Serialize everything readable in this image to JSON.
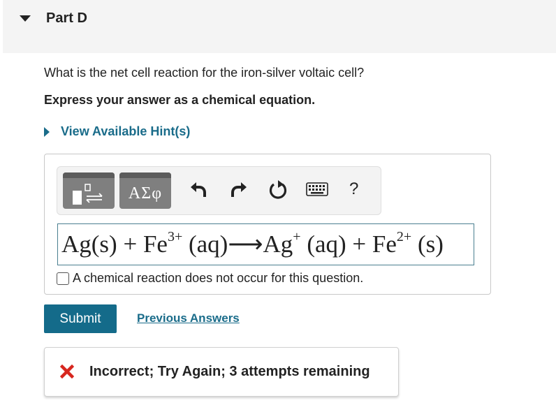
{
  "part": {
    "title": "Part D"
  },
  "question": {
    "text": "What is the net cell reaction for the iron-silver voltaic cell?"
  },
  "instruction": {
    "text": "Express your answer as a chemical equation."
  },
  "hints": {
    "label": "View Available Hint(s)"
  },
  "toolbar": {
    "templates_icon": "templates-icon",
    "symbols_label": "ΑΣφ",
    "undo_icon": "undo-icon",
    "redo_icon": "redo-icon",
    "reset_icon": "reset-icon",
    "keyboard_icon": "keyboard-icon",
    "help_label": "?"
  },
  "answer": {
    "t1": "Ag(s) + Fe",
    "c1": "3+",
    "t2": " (aq)⟶Ag",
    "c2": "+",
    "t3": " (aq) + Fe",
    "c3": "2+",
    "t4": " (s)"
  },
  "no_reaction": {
    "label": "A chemical reaction does not occur for this question.",
    "checked": false
  },
  "submit": {
    "label": "Submit"
  },
  "previous_answers": {
    "label": "Previous Answers"
  },
  "feedback": {
    "icon": "x-icon",
    "text": "Incorrect; Try Again; 3 attempts remaining",
    "color": "#d7261e"
  },
  "colors": {
    "accent": "#146b8a",
    "link": "#1a6c8a",
    "header_bg": "#f4f4f4"
  }
}
